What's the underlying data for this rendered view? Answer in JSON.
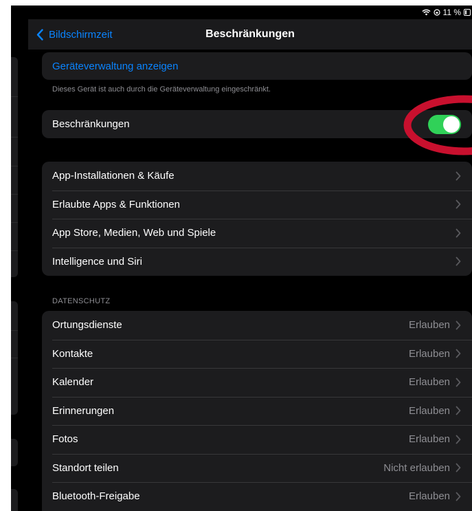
{
  "statusbar": {
    "wifi_icon": "wifi-icon",
    "orientation_lock_icon": "orientation-lock-icon",
    "battery_text": "11 %",
    "battery_icon": "battery-icon"
  },
  "navbar": {
    "back_label": "Bildschirmzeit",
    "title": "Beschränkungen"
  },
  "management": {
    "link_label": "Geräteverwaltung anzeigen",
    "footnote": "Dieses Gerät ist auch durch die Geräteverwaltung eingeschränkt."
  },
  "restrictions_toggle": {
    "label": "Beschränkungen",
    "on": true
  },
  "main_items": [
    {
      "label": "App-Installationen & Käufe"
    },
    {
      "label": "Erlaubte Apps & Funktionen"
    },
    {
      "label": "App Store, Medien, Web und Spiele"
    },
    {
      "label": "Intelligence und Siri"
    }
  ],
  "privacy": {
    "header": "DATENSCHUTZ",
    "items": [
      {
        "label": "Ortungsdienste",
        "value": "Erlauben"
      },
      {
        "label": "Kontakte",
        "value": "Erlauben"
      },
      {
        "label": "Kalender",
        "value": "Erlauben"
      },
      {
        "label": "Erinnerungen",
        "value": "Erlauben"
      },
      {
        "label": "Fotos",
        "value": "Erlauben"
      },
      {
        "label": "Standort teilen",
        "value": "Nicht erlauben"
      },
      {
        "label": "Bluetooth-Freigabe",
        "value": "Erlauben"
      }
    ]
  },
  "colors": {
    "accent": "#0a84ff",
    "toggle_on": "#30d158",
    "annotation": "#c8102e",
    "cell_background": "#1c1c1e",
    "secondary_text": "#8e8e93"
  }
}
